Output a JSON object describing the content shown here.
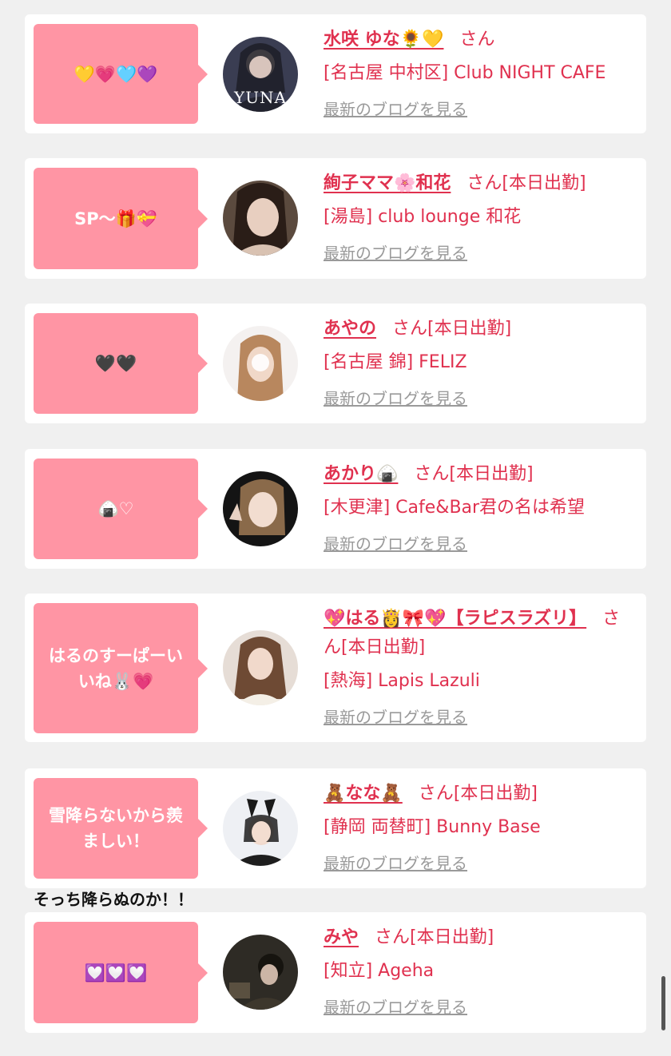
{
  "items": [
    {
      "message": "💛💗🩵💜",
      "name": "水咲 ゆな🌻💛",
      "suffix": "さん",
      "status": "",
      "store": "[名古屋 中村区] Club NIGHT CAFE",
      "blog": "最新のブログを見る",
      "avatar_text": "YUNA"
    },
    {
      "message": "SP〜🎁💝",
      "name": "絢子ママ🌸和花",
      "suffix": "さん",
      "status": "[本日出勤]",
      "store": "[湯島] club lounge 和花",
      "blog": "最新のブログを見る",
      "avatar_text": ""
    },
    {
      "message": "🖤🖤",
      "name": "あやの",
      "suffix": "さん",
      "status": "[本日出勤]",
      "store": "[名古屋 錦] FELIZ",
      "blog": "最新のブログを見る",
      "avatar_text": ""
    },
    {
      "message": "🍙♡",
      "name": "あかり🍙",
      "suffix": "さん",
      "status": "[本日出勤]",
      "store": "[木更津] Cafe&Bar君の名は希望",
      "blog": "最新のブログを見る",
      "avatar_text": ""
    },
    {
      "message": "はるのすーぱーいいね🐰💗",
      "name": "💖はる👸🎀💖【ラピスラズリ】",
      "suffix": "さん",
      "status": "[本日出勤]",
      "store": "[熱海] Lapis Lazuli",
      "blog": "最新のブログを見る",
      "avatar_text": ""
    },
    {
      "message": "雪降らないから羨ましい！",
      "name": "🧸なな🧸",
      "suffix": "さん",
      "status": "[本日出勤]",
      "store": "[静岡 両替町] Bunny Base",
      "blog": "最新のブログを見る",
      "avatar_text": ""
    },
    {
      "message": "💟💟💟",
      "name": "みや",
      "suffix": "さん",
      "status": "[本日出勤]",
      "store": "[知立] Ageha",
      "blog": "最新のブログを見る",
      "avatar_text": ""
    }
  ],
  "overlay_comment": "そっち降らぬのか！！",
  "colors": {
    "background": "#f0f0f0",
    "card": "#ffffff",
    "bubble": "#ff95a4",
    "accent": "#e0314f",
    "muted": "#9a9a9a"
  }
}
